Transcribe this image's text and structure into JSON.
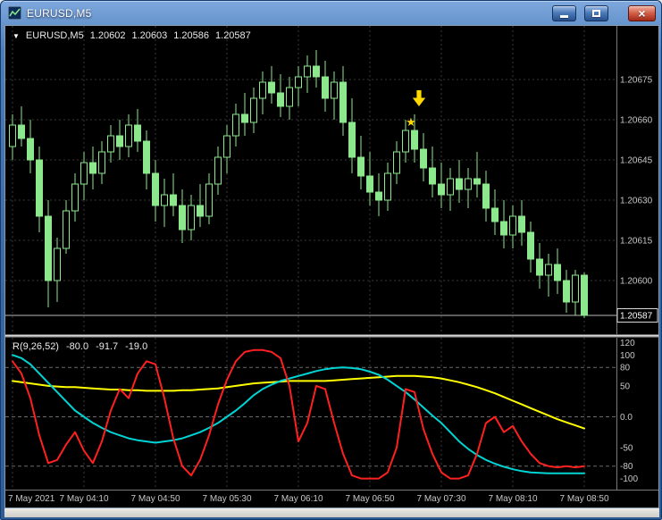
{
  "window": {
    "title": "EURUSD,M5",
    "controls": {
      "close": "×"
    }
  },
  "icons": {
    "menu_arrow": "▼"
  },
  "chart": {
    "symbol_label": "EURUSD,M5",
    "open": "1.20602",
    "high": "1.20603",
    "low": "1.20586",
    "close": "1.20587"
  },
  "indicator": {
    "name": "R(9,26,52)",
    "values": [
      "-80.0",
      "-91.7",
      "-19.0"
    ]
  },
  "colors": {
    "background": "#000000",
    "candle": "#8de88d",
    "grid": "#383838",
    "axis_text": "#c8c8c8",
    "bid_line": "#b8b8b8",
    "annotation": "#ffd800",
    "titlebar_blue": "#38679f",
    "close_red": "#c8412f"
  },
  "chart_data": {
    "type": "candlestick",
    "title": "EURUSD,M5",
    "timeframe_minutes": 5,
    "price_axis": {
      "min": 1.2058,
      "max": 1.20695,
      "ticks": [
        "1.20675",
        "1.20660",
        "1.20645",
        "1.20630",
        "1.20615",
        "1.20600"
      ],
      "current": "1.20587"
    },
    "x_axis": {
      "labels": [
        "7 May 2021",
        "7 May 04:10",
        "7 May 04:50",
        "7 May 05:30",
        "7 May 06:10",
        "7 May 06:50",
        "7 May 07:30",
        "7 May 08:10",
        "7 May 08:50"
      ],
      "gridline_every_bars": 8
    },
    "candles": [
      [
        1.2065,
        1.20662,
        1.20645,
        1.20658
      ],
      [
        1.20658,
        1.20665,
        1.2065,
        1.20653
      ],
      [
        1.20653,
        1.2066,
        1.2064,
        1.20645
      ],
      [
        1.20645,
        1.2065,
        1.20618,
        1.20624
      ],
      [
        1.20624,
        1.2063,
        1.2059,
        1.206
      ],
      [
        1.206,
        1.20616,
        1.20592,
        1.20612
      ],
      [
        1.20612,
        1.2063,
        1.2061,
        1.20626
      ],
      [
        1.20626,
        1.2064,
        1.20622,
        1.20636
      ],
      [
        1.20636,
        1.20648,
        1.2063,
        1.20644
      ],
      [
        1.20644,
        1.2065,
        1.20634,
        1.2064
      ],
      [
        1.2064,
        1.20652,
        1.20636,
        1.20648
      ],
      [
        1.20648,
        1.20658,
        1.20644,
        1.20654
      ],
      [
        1.20654,
        1.2066,
        1.20645,
        1.2065
      ],
      [
        1.2065,
        1.20662,
        1.20646,
        1.20658
      ],
      [
        1.20658,
        1.20664,
        1.20648,
        1.20652
      ],
      [
        1.20652,
        1.20656,
        1.20634,
        1.2064
      ],
      [
        1.2064,
        1.20645,
        1.20622,
        1.20628
      ],
      [
        1.20628,
        1.20638,
        1.2062,
        1.20632
      ],
      [
        1.20632,
        1.2064,
        1.20624,
        1.20628
      ],
      [
        1.20628,
        1.20634,
        1.20614,
        1.20619
      ],
      [
        1.20619,
        1.20632,
        1.20615,
        1.20628
      ],
      [
        1.20628,
        1.20636,
        1.2062,
        1.20624
      ],
      [
        1.20624,
        1.2064,
        1.20621,
        1.20636
      ],
      [
        1.20636,
        1.2065,
        1.20632,
        1.20646
      ],
      [
        1.20646,
        1.20658,
        1.2064,
        1.20654
      ],
      [
        1.20654,
        1.20666,
        1.2065,
        1.20662
      ],
      [
        1.20662,
        1.2067,
        1.20654,
        1.20659
      ],
      [
        1.20659,
        1.20672,
        1.20655,
        1.20668
      ],
      [
        1.20668,
        1.20678,
        1.20662,
        1.20674
      ],
      [
        1.20674,
        1.2068,
        1.20666,
        1.2067
      ],
      [
        1.2067,
        1.20677,
        1.20661,
        1.20665
      ],
      [
        1.20665,
        1.20676,
        1.2066,
        1.20672
      ],
      [
        1.20672,
        1.2068,
        1.20665,
        1.20676
      ],
      [
        1.20676,
        1.20684,
        1.2067,
        1.2068
      ],
      [
        1.2068,
        1.20686,
        1.20672,
        1.20676
      ],
      [
        1.20676,
        1.20682,
        1.20663,
        1.20668
      ],
      [
        1.20668,
        1.20678,
        1.2066,
        1.20674
      ],
      [
        1.20674,
        1.2068,
        1.20654,
        1.20659
      ],
      [
        1.20659,
        1.20668,
        1.2064,
        1.20646
      ],
      [
        1.20646,
        1.20654,
        1.20634,
        1.20639
      ],
      [
        1.20639,
        1.20648,
        1.20628,
        1.20633
      ],
      [
        1.20633,
        1.2064,
        1.20624,
        1.2063
      ],
      [
        1.2063,
        1.20644,
        1.20626,
        1.2064
      ],
      [
        1.2064,
        1.20652,
        1.20636,
        1.20648
      ],
      [
        1.20648,
        1.2066,
        1.20644,
        1.20656
      ],
      [
        1.20656,
        1.20662,
        1.20644,
        1.20649
      ],
      [
        1.20649,
        1.20655,
        1.20637,
        1.20642
      ],
      [
        1.20642,
        1.2065,
        1.20631,
        1.20636
      ],
      [
        1.20636,
        1.20644,
        1.20627,
        1.20632
      ],
      [
        1.20632,
        1.20642,
        1.20626,
        1.20638
      ],
      [
        1.20638,
        1.20645,
        1.20629,
        1.20634
      ],
      [
        1.20634,
        1.20642,
        1.20627,
        1.20638
      ],
      [
        1.20638,
        1.20648,
        1.20631,
        1.20636
      ],
      [
        1.20636,
        1.20641,
        1.20622,
        1.20627
      ],
      [
        1.20627,
        1.20634,
        1.20617,
        1.20622
      ],
      [
        1.20622,
        1.2063,
        1.20612,
        1.20617
      ],
      [
        1.20617,
        1.20628,
        1.20612,
        1.20624
      ],
      [
        1.20624,
        1.2063,
        1.20613,
        1.20618
      ],
      [
        1.20618,
        1.20622,
        1.20603,
        1.20608
      ],
      [
        1.20608,
        1.20614,
        1.20597,
        1.20602
      ],
      [
        1.20602,
        1.2061,
        1.20594,
        1.20606
      ],
      [
        1.20606,
        1.20612,
        1.20595,
        1.206
      ],
      [
        1.206,
        1.20604,
        1.20588,
        1.20592
      ],
      [
        1.20592,
        1.20604,
        1.20587,
        1.20602
      ],
      [
        1.20602,
        1.20603,
        1.20586,
        1.20587
      ]
    ],
    "annotations": [
      {
        "type": "arrow-down",
        "bar": 45.5,
        "price": 1.20665,
        "color": "#ffd800"
      },
      {
        "type": "star",
        "bar": 44.6,
        "price": 1.20659,
        "color": "#ffd800"
      }
    ],
    "indicator": {
      "name": "R(9,26,52)",
      "range": [
        -118,
        128
      ],
      "ticks": [
        "120",
        "100",
        "80",
        "50",
        "0.0",
        "-50",
        "-80",
        "-100"
      ],
      "levels": [
        80,
        0,
        -80
      ],
      "series": [
        {
          "name": "r-fast",
          "color": "#ff2020",
          "last": "-80.0",
          "values": [
            90,
            70,
            30,
            -30,
            -75,
            -70,
            -45,
            -25,
            -55,
            -75,
            -40,
            10,
            45,
            30,
            70,
            90,
            85,
            30,
            -35,
            -80,
            -95,
            -70,
            -30,
            20,
            60,
            90,
            105,
            108,
            108,
            105,
            95,
            50,
            -40,
            -10,
            50,
            45,
            -10,
            -60,
            -95,
            -100,
            -100,
            -100,
            -90,
            -50,
            45,
            40,
            -20,
            -60,
            -90,
            -100,
            -100,
            -95,
            -60,
            -10,
            0,
            -25,
            -15,
            -40,
            -60,
            -75,
            -80,
            -82,
            -80,
            -82,
            -80
          ]
        },
        {
          "name": "r-mid",
          "color": "#00d4d4",
          "last": "-91.7",
          "values": [
            100,
            95,
            85,
            70,
            55,
            40,
            25,
            10,
            0,
            -10,
            -18,
            -25,
            -30,
            -35,
            -38,
            -40,
            -42,
            -40,
            -38,
            -35,
            -30,
            -25,
            -18,
            -10,
            0,
            10,
            22,
            35,
            45,
            52,
            58,
            62,
            66,
            70,
            74,
            77,
            79,
            80,
            79,
            77,
            73,
            68,
            60,
            50,
            40,
            28,
            15,
            2,
            -10,
            -25,
            -40,
            -52,
            -62,
            -70,
            -76,
            -81,
            -85,
            -88,
            -90,
            -91,
            -91.5,
            -91.7,
            -91.7,
            -91.7,
            -91.7
          ]
        },
        {
          "name": "r-slow",
          "color": "#ffff00",
          "last": "-19.0",
          "values": [
            58,
            56,
            54,
            52,
            50,
            49,
            48,
            48,
            47,
            46,
            45,
            44,
            44,
            43,
            43,
            42,
            42,
            42,
            42,
            43,
            43,
            44,
            45,
            46,
            48,
            50,
            52,
            54,
            55,
            56,
            57,
            58,
            58,
            58,
            58,
            58,
            59,
            60,
            61,
            62,
            63,
            64,
            65,
            66,
            66,
            66,
            65,
            64,
            62,
            59,
            56,
            52,
            48,
            43,
            38,
            32,
            26,
            20,
            14,
            8,
            2,
            -4,
            -9,
            -14,
            -19
          ]
        }
      ]
    }
  }
}
